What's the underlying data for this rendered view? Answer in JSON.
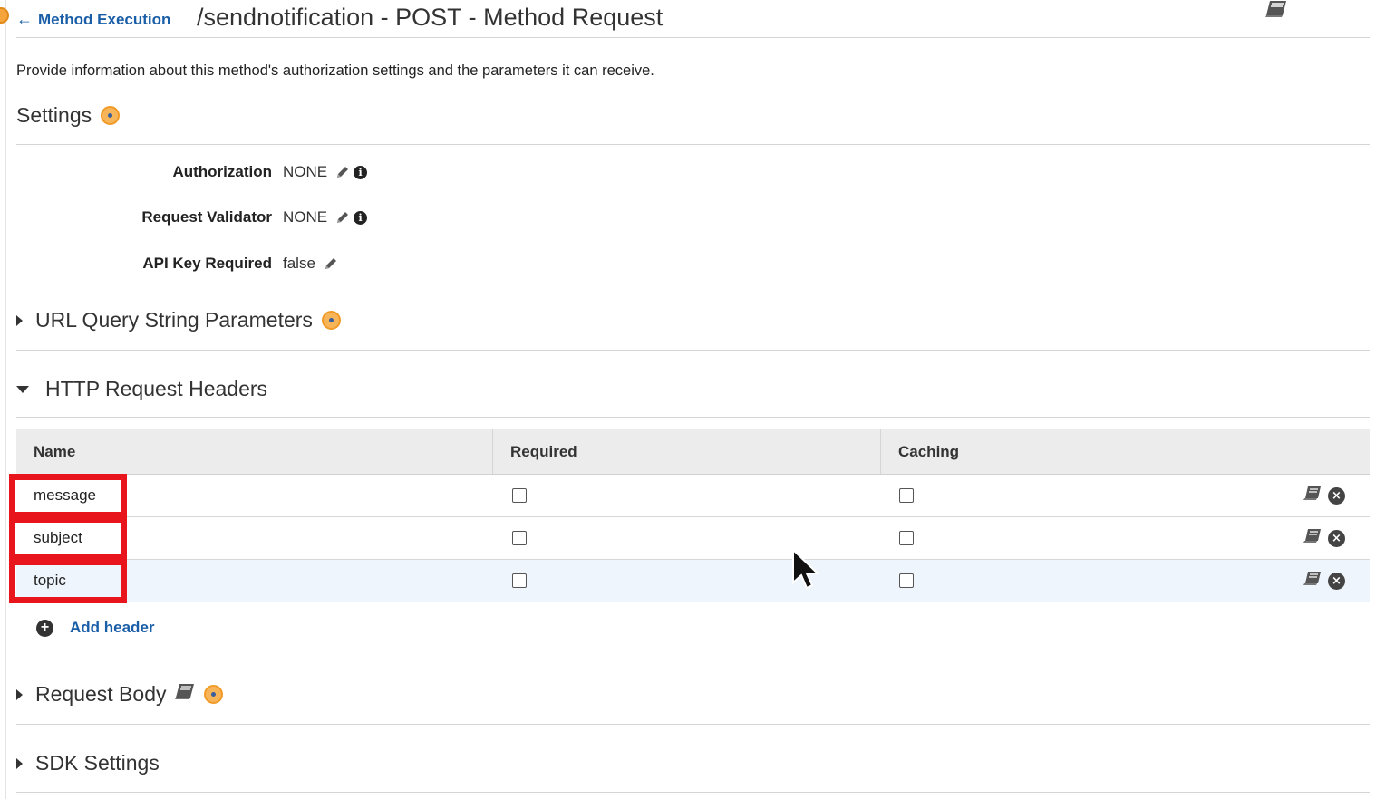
{
  "header": {
    "back_label": "Method Execution",
    "title": "/sendnotification - POST - Method Request"
  },
  "intro": "Provide information about this method's authorization settings and the parameters it can receive.",
  "settings": {
    "heading": "Settings",
    "rows": [
      {
        "key": "Authorization",
        "value": "NONE"
      },
      {
        "key": "Request Validator",
        "value": "NONE"
      },
      {
        "key": "API Key Required",
        "value": "false"
      }
    ]
  },
  "sections": {
    "url_query": "URL Query String Parameters",
    "http_headers": "HTTP Request Headers",
    "request_body": "Request Body",
    "sdk_settings": "SDK Settings"
  },
  "headers_table": {
    "columns": [
      "Name",
      "Required",
      "Caching"
    ],
    "rows": [
      {
        "name": "message",
        "required": false,
        "caching": false
      },
      {
        "name": "subject",
        "required": false,
        "caching": false
      },
      {
        "name": "topic",
        "required": false,
        "caching": false
      }
    ]
  },
  "add_header_label": "Add header",
  "icons": {
    "back": "arrow-left-icon",
    "docs": "book-icon",
    "info": "info-dot-icon",
    "edit": "pencil-icon",
    "remove": "close-circle-icon",
    "add": "plus-circle-icon"
  },
  "colors": {
    "link": "#1a5ea8",
    "highlight_box": "#e8151d",
    "info_dot": "#f7b55a",
    "selected_row": "#eef5fc"
  }
}
